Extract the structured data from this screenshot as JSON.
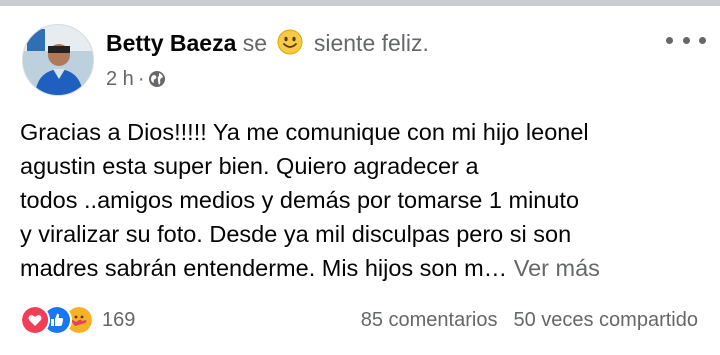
{
  "post": {
    "author": "Betty Baeza",
    "feeling_prefix": "se",
    "feeling_emoji": "smiling-face-icon",
    "feeling_text": "siente feliz.",
    "timestamp": "2 h",
    "separator": "·",
    "privacy_icon": "globe-icon",
    "text_lines": [
      "Gracias a Dios!!!!! Ya me comunique con mi hijo leonel",
      "agustin esta super bien. Quiero agradecer a",
      "todos ..amigos medios y demás por tomarse 1 minuto",
      "y viralizar su foto. Desde ya mil disculpas pero si son",
      "madres sabrán entenderme. Mis hijos son m… "
    ],
    "see_more_label": "Ver más"
  },
  "reactions": {
    "icons": [
      "love-reaction-icon",
      "like-reaction-icon",
      "care-reaction-icon"
    ],
    "count": "169"
  },
  "stats": {
    "comments": "85 comentarios",
    "shares": "50 veces compartido"
  },
  "colors": {
    "secondary_text": "#65676b",
    "like_blue": "#1877f2",
    "love_red": "#f33e58",
    "care_yellow": "#f7b125"
  }
}
